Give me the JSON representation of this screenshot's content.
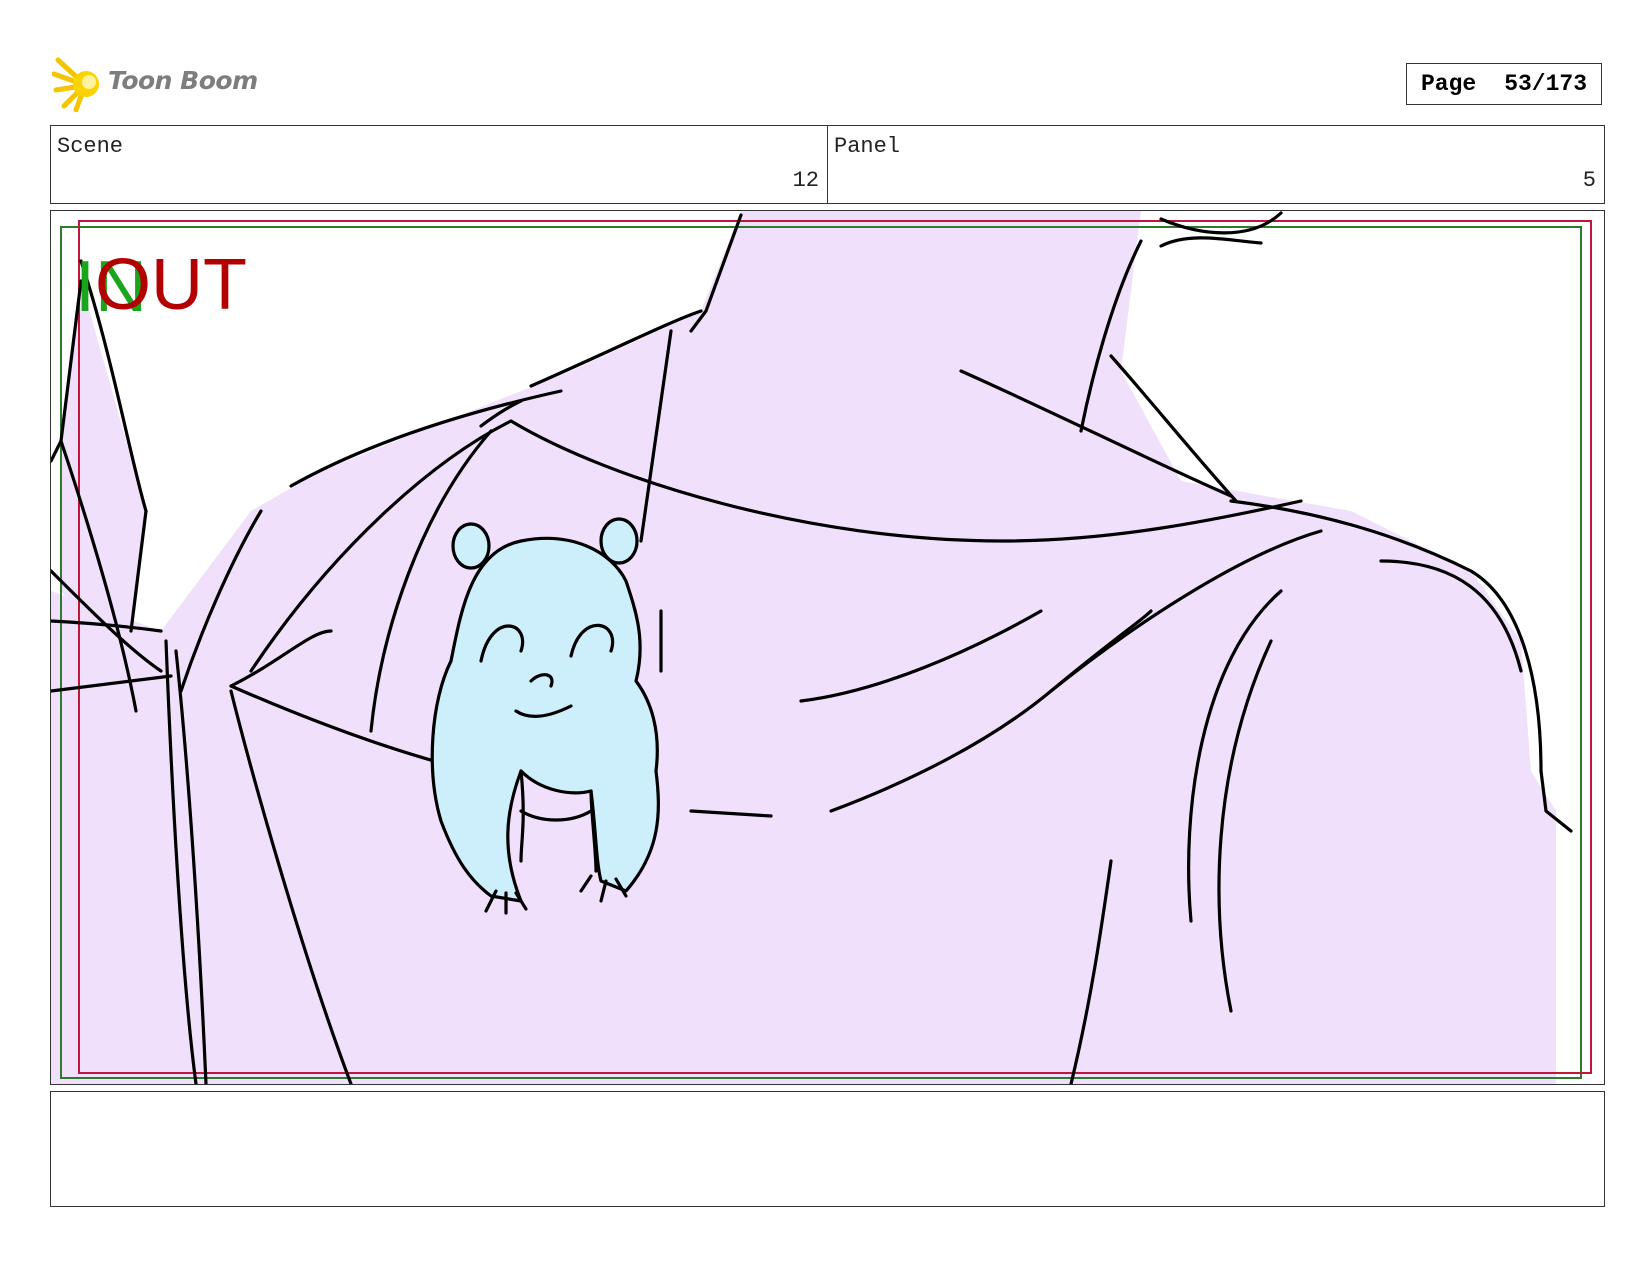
{
  "brand": {
    "name": "Toon Boom"
  },
  "page": {
    "label": "Page",
    "number": "53/173"
  },
  "scene": {
    "label": "Scene",
    "value": "12"
  },
  "panel": {
    "label": "Panel",
    "value": "5"
  },
  "frame_markers": {
    "in_label": "IN",
    "out_label": "OUT",
    "in_color": "#1aa61a",
    "out_color": "#b30000"
  },
  "colors": {
    "cloth": "#f1e0fb",
    "hamster": "#cdeefb",
    "safe_frame": "#2d7a2d",
    "action_frame": "#c0163a"
  },
  "notes": {
    "text": ""
  }
}
